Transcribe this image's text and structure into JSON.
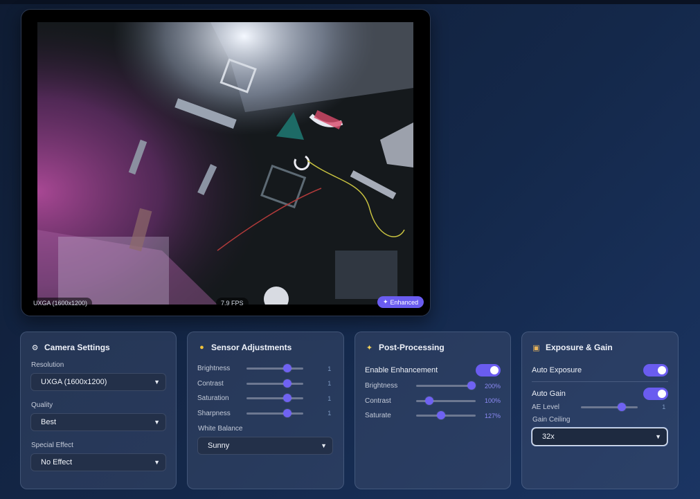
{
  "video": {
    "resolution_tag": "UXGA (1600x1200)",
    "fps_tag": "7.9 FPS",
    "enhanced_tag": "Enhanced"
  },
  "camera_settings": {
    "title": "Camera Settings",
    "icon": "gear-icon",
    "resolution_label": "Resolution",
    "resolution_value": "UXGA (1600x1200)",
    "quality_label": "Quality",
    "quality_value": "Best",
    "effect_label": "Special Effect",
    "effect_value": "No Effect"
  },
  "sensor": {
    "title": "Sensor Adjustments",
    "icon": "palette-icon",
    "sliders": [
      {
        "label": "Brightness",
        "value": "1",
        "level": 0.72
      },
      {
        "label": "Contrast",
        "value": "1",
        "level": 0.72
      },
      {
        "label": "Saturation",
        "value": "1",
        "level": 0.72
      },
      {
        "label": "Sharpness",
        "value": "1",
        "level": 0.72
      }
    ],
    "wb_label": "White Balance",
    "wb_value": "Sunny"
  },
  "post": {
    "title": "Post-Processing",
    "icon": "sparkle-icon",
    "enable_label": "Enable Enhancement",
    "enable_on": true,
    "sliders": [
      {
        "label": "Brightness",
        "value": "200%",
        "level": 0.93
      },
      {
        "label": "Contrast",
        "value": "100%",
        "level": 0.22
      },
      {
        "label": "Saturate",
        "value": "127%",
        "level": 0.41
      }
    ]
  },
  "exposure": {
    "title": "Exposure & Gain",
    "icon": "camera-icon",
    "auto_exposure_label": "Auto Exposure",
    "auto_exposure_on": true,
    "auto_gain_label": "Auto Gain",
    "auto_gain_on": true,
    "ae_label": "AE Level",
    "ae_value": "1",
    "ae_level": 0.72,
    "gain_label": "Gain Ceiling",
    "gain_value": "32x"
  },
  "colors": {
    "accent": "#6a5cf0",
    "value_text": "#8d8af5"
  }
}
